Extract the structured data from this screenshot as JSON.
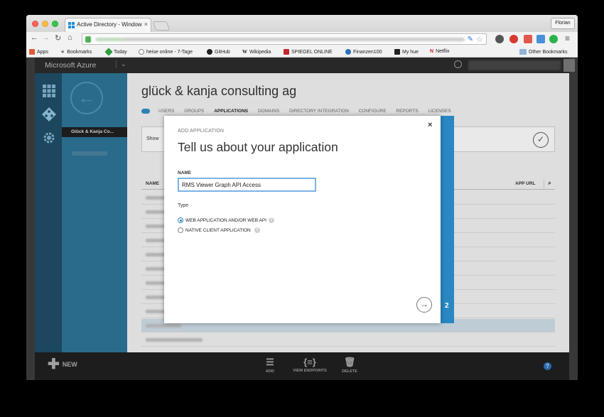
{
  "browser": {
    "tab_title": "Active Directory - Windows",
    "tab_close": "×",
    "profile_name": "Florian",
    "bookmarks": [
      {
        "label": "Apps",
        "icon": "apps-grid-icon",
        "color": "#e05a3a"
      },
      {
        "label": "Bookmarks",
        "icon": "star-icon",
        "color": "#666666"
      },
      {
        "label": "Today",
        "icon": "today-icon",
        "color": "#2e9e3e"
      },
      {
        "label": "heise online - 7-Tage",
        "icon": "heise-icon",
        "color": "#888888"
      },
      {
        "label": "GitHub",
        "icon": "github-icon",
        "color": "#222222"
      },
      {
        "label": "Wikipedia",
        "icon": "wikipedia-icon",
        "color": "#444444"
      },
      {
        "label": "SPIEGEL ONLINE",
        "icon": "spiegel-icon",
        "color": "#c0282d"
      },
      {
        "label": "Finanzen100",
        "icon": "finanzen-icon",
        "color": "#2d6fb8"
      },
      {
        "label": "My hue",
        "icon": "hue-icon",
        "color": "#222222"
      },
      {
        "label": "Netflix",
        "icon": "netflix-icon",
        "color": "#d81f26"
      }
    ],
    "other_bookmarks": "Other Bookmarks"
  },
  "azure": {
    "brand": "Microsoft Azure",
    "org_title": "glück & kanja consulting ag",
    "directory_item": "Glück & Kanja Co...",
    "tabs": [
      {
        "label": "USERS",
        "active": false
      },
      {
        "label": "GROUPS",
        "active": false
      },
      {
        "label": "APPLICATIONS",
        "active": true
      },
      {
        "label": "DOMAINS",
        "active": false
      },
      {
        "label": "DIRECTORY INTEGRATION",
        "active": false
      },
      {
        "label": "CONFIGURE",
        "active": false
      },
      {
        "label": "REPORTS",
        "active": false
      },
      {
        "label": "LICENSES",
        "active": false
      }
    ],
    "show_label": "Show",
    "table_headers": {
      "name": "NAME",
      "app_url": "APP URL"
    },
    "commands": {
      "new": "NEW",
      "add": "ADD",
      "view_endpoints": "VIEW ENDPOINTS",
      "delete": "DELETE"
    },
    "help": "?"
  },
  "dialog": {
    "subtitle": "ADD APPLICATION",
    "title": "Tell us about your application",
    "close": "×",
    "name_label": "NAME",
    "name_value": "RMS Viewer Graph API Access",
    "type_label": "Type",
    "options": [
      {
        "label": "WEB APPLICATION AND/OR WEB API",
        "selected": true
      },
      {
        "label": "NATIVE CLIENT APPLICATION",
        "selected": false
      }
    ],
    "help_glyph": "?",
    "next_arrow": "→",
    "step": "2"
  },
  "colors": {
    "accent": "#2a87c3",
    "nav_dark": "#1e4c65",
    "nav_mid": "#2d7194"
  }
}
